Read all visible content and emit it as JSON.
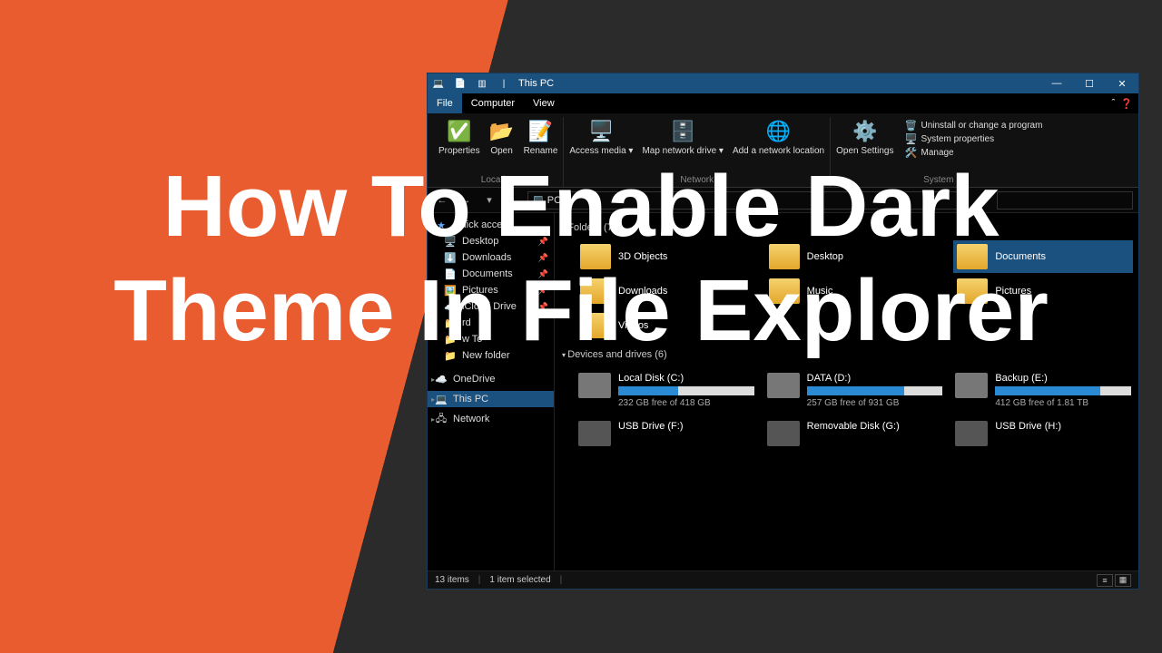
{
  "headline": "How To Enable Dark Theme In File Explorer",
  "titlebar": {
    "title": "This PC"
  },
  "wincontrols": {
    "min": "—",
    "max": "☐",
    "close": "✕"
  },
  "menubar": {
    "file": "File",
    "computer": "Computer",
    "view": "View"
  },
  "ribbon": {
    "g1": {
      "label": "Location",
      "properties": "Properties",
      "open": "Open",
      "rename": "Rename"
    },
    "g2": {
      "label": "Network",
      "access": "Access media ▾",
      "map": "Map network drive ▾",
      "add": "Add a network location"
    },
    "g3": {
      "label": "System",
      "settings": "Open Settings",
      "uninstall": "Uninstall or change a program",
      "props": "System properties",
      "manage": "Manage"
    }
  },
  "nav": {
    "back": "←",
    "fwd": "→",
    "up": "↑",
    "refresh": "⟳",
    "address": "PC"
  },
  "sidebar": {
    "quick": "Quick access",
    "items": [
      {
        "label": "Desktop"
      },
      {
        "label": "Downloads"
      },
      {
        "label": "Documents"
      },
      {
        "label": "Pictures"
      },
      {
        "label": "iCloud Drive"
      },
      {
        "label": "rd"
      },
      {
        "label": "w To"
      },
      {
        "label": "New folder"
      }
    ],
    "onedrive": "OneDrive",
    "thispc": "This PC",
    "network": "Network"
  },
  "content": {
    "foldersHeader": "Folders (7)",
    "folders": [
      {
        "label": "3D Objects"
      },
      {
        "label": "Desktop"
      },
      {
        "label": "Documents"
      },
      {
        "label": "Downloads"
      },
      {
        "label": "Music"
      },
      {
        "label": "Pictures"
      },
      {
        "label": "Videos"
      }
    ],
    "drivesHeader": "Devices and drives (6)",
    "drives": [
      {
        "name": "Local Disk (C:)",
        "free": "232 GB free of 418 GB",
        "pct": 44
      },
      {
        "name": "DATA (D:)",
        "free": "257 GB free of 931 GB",
        "pct": 72
      },
      {
        "name": "Backup (E:)",
        "free": "412 GB free of 1.81 TB",
        "pct": 77
      },
      {
        "name": "USB Drive (F:)"
      },
      {
        "name": "Removable Disk (G:)"
      },
      {
        "name": "USB Drive (H:)"
      }
    ]
  },
  "status": {
    "items": "13 items",
    "selected": "1 item selected"
  }
}
